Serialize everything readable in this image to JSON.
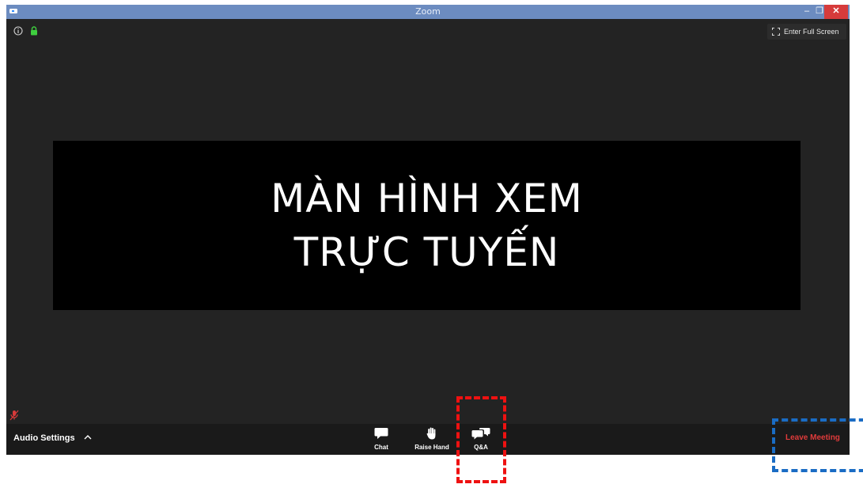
{
  "window": {
    "title": "Zoom",
    "minimize_glyph": "–",
    "restore_glyph": "❐",
    "close_glyph": "✕"
  },
  "top_bar": {
    "info_icon": "info-icon",
    "lock_icon": "lock-icon",
    "fullscreen_label": "Enter Full Screen"
  },
  "shared_screen": {
    "line1": "MÀN HÌNH XEM",
    "line2": "TRỰC TUYẾN"
  },
  "toolbar": {
    "audio_settings_label": "Audio Settings",
    "chat_label": "Chat",
    "raise_hand_label": "Raise Hand",
    "qa_label": "Q&A",
    "leave_label": "Leave Meeting"
  },
  "colors": {
    "title_bar": "#6c8cc0",
    "window_background": "#232323",
    "toolbar_background": "#1a1a1a",
    "leave_text": "#e03b3b",
    "qa_highlight": "#ee1111",
    "leave_highlight": "#1a6cc4",
    "lock": "#3fcf3f"
  }
}
